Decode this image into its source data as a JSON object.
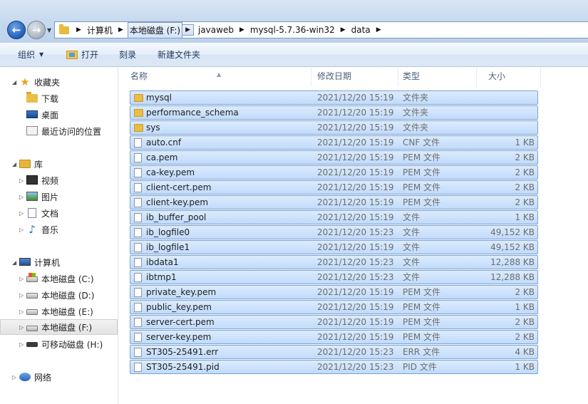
{
  "address": {
    "crumbs": [
      "计算机",
      "本地磁盘 (F:)",
      "javaweb",
      "mysql-5.7.36-win32",
      "data"
    ]
  },
  "toolbar": {
    "organize": "组织",
    "open": "打开",
    "burn": "刻录",
    "new_folder": "新建文件夹"
  },
  "nav": {
    "favorites": "收藏夹",
    "downloads": "下载",
    "desktop": "桌面",
    "recent": "最近访问的位置",
    "libraries": "库",
    "videos": "视频",
    "pictures": "图片",
    "documents": "文档",
    "music": "音乐",
    "computer": "计算机",
    "drive_c": "本地磁盘 (C:)",
    "drive_d": "本地磁盘 (D:)",
    "drive_e": "本地磁盘 (E:)",
    "drive_f": "本地磁盘 (F:)",
    "drive_h": "可移动磁盘 (H:)",
    "network": "网络"
  },
  "columns": {
    "name": "名称",
    "date": "修改日期",
    "type": "类型",
    "size": "大小"
  },
  "files": [
    {
      "name": "mysql",
      "date": "2021/12/20 15:19",
      "type": "文件夹",
      "size": "",
      "icon": "folder-icon"
    },
    {
      "name": "performance_schema",
      "date": "2021/12/20 15:19",
      "type": "文件夹",
      "size": "",
      "icon": "folder-icon"
    },
    {
      "name": "sys",
      "date": "2021/12/20 15:19",
      "type": "文件夹",
      "size": "",
      "icon": "folder-icon"
    },
    {
      "name": "auto.cnf",
      "date": "2021/12/20 15:19",
      "type": "CNF 文件",
      "size": "1 KB",
      "icon": "file-icon"
    },
    {
      "name": "ca.pem",
      "date": "2021/12/20 15:19",
      "type": "PEM 文件",
      "size": "2 KB",
      "icon": "file-icon"
    },
    {
      "name": "ca-key.pem",
      "date": "2021/12/20 15:19",
      "type": "PEM 文件",
      "size": "2 KB",
      "icon": "file-icon"
    },
    {
      "name": "client-cert.pem",
      "date": "2021/12/20 15:19",
      "type": "PEM 文件",
      "size": "2 KB",
      "icon": "file-icon"
    },
    {
      "name": "client-key.pem",
      "date": "2021/12/20 15:19",
      "type": "PEM 文件",
      "size": "2 KB",
      "icon": "file-icon"
    },
    {
      "name": "ib_buffer_pool",
      "date": "2021/12/20 15:19",
      "type": "文件",
      "size": "1 KB",
      "icon": "file-icon"
    },
    {
      "name": "ib_logfile0",
      "date": "2021/12/20 15:23",
      "type": "文件",
      "size": "49,152 KB",
      "icon": "file-icon"
    },
    {
      "name": "ib_logfile1",
      "date": "2021/12/20 15:19",
      "type": "文件",
      "size": "49,152 KB",
      "icon": "file-icon"
    },
    {
      "name": "ibdata1",
      "date": "2021/12/20 15:23",
      "type": "文件",
      "size": "12,288 KB",
      "icon": "file-icon"
    },
    {
      "name": "ibtmp1",
      "date": "2021/12/20 15:23",
      "type": "文件",
      "size": "12,288 KB",
      "icon": "file-icon"
    },
    {
      "name": "private_key.pem",
      "date": "2021/12/20 15:19",
      "type": "PEM 文件",
      "size": "2 KB",
      "icon": "file-icon"
    },
    {
      "name": "public_key.pem",
      "date": "2021/12/20 15:19",
      "type": "PEM 文件",
      "size": "1 KB",
      "icon": "file-icon"
    },
    {
      "name": "server-cert.pem",
      "date": "2021/12/20 15:19",
      "type": "PEM 文件",
      "size": "2 KB",
      "icon": "file-icon"
    },
    {
      "name": "server-key.pem",
      "date": "2021/12/20 15:19",
      "type": "PEM 文件",
      "size": "2 KB",
      "icon": "file-icon"
    },
    {
      "name": "ST305-25491.err",
      "date": "2021/12/20 15:23",
      "type": "ERR 文件",
      "size": "4 KB",
      "icon": "file-icon"
    },
    {
      "name": "ST305-25491.pid",
      "date": "2021/12/20 15:23",
      "type": "PID 文件",
      "size": "1 KB",
      "icon": "file-icon"
    }
  ]
}
